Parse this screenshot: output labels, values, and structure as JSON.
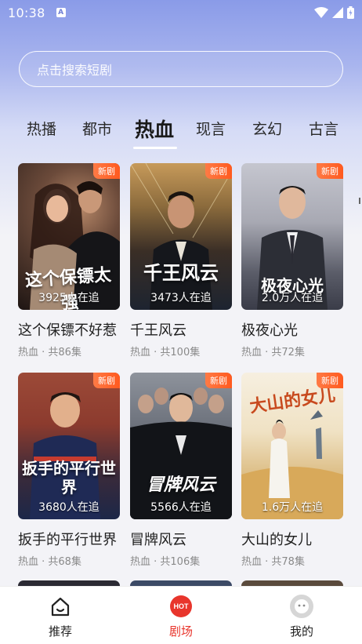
{
  "status_bar": {
    "time": "10:38",
    "indicator": "A"
  },
  "search": {
    "placeholder": "点击搜索短剧"
  },
  "tabs": [
    {
      "label": "热播"
    },
    {
      "label": "都市"
    },
    {
      "label": "热血",
      "active": true
    },
    {
      "label": "现言"
    },
    {
      "label": "玄幻"
    },
    {
      "label": "古言"
    }
  ],
  "dramas": [
    {
      "poster_text": "这个保镖太强",
      "badge": "新剧",
      "watching": "3925人在追",
      "title": "这个保镖不好惹",
      "meta": "热血 · 共86集",
      "colors": [
        "#6b4a3a",
        "#1e1513"
      ]
    },
    {
      "poster_text": "千王风云",
      "badge": "新剧",
      "watching": "3473人在追",
      "title": "千王风云",
      "meta": "热血 · 共100集",
      "colors": [
        "#8a6a3c",
        "#1d2430"
      ]
    },
    {
      "poster_text": "极夜心光",
      "badge": "新剧",
      "watching": "2.0万人在追",
      "title": "极夜心光",
      "meta": "热血 · 共72集",
      "colors": [
        "#a8a9b3",
        "#3a3c48"
      ]
    },
    {
      "poster_text": "扳手的平行世界",
      "badge": "新剧",
      "watching": "3680人在追",
      "title": "扳手的平行世界",
      "meta": "热血 · 共68集",
      "colors": [
        "#8c3b2e",
        "#1c2748"
      ]
    },
    {
      "poster_text": "冒牌风云",
      "badge": "新剧",
      "watching": "5566人在追",
      "title": "冒牌风云",
      "meta": "热血 · 共106集",
      "colors": [
        "#6e737d",
        "#14171c"
      ]
    },
    {
      "poster_text": "大山的女儿",
      "badge": "新剧",
      "watching": "1.6万人在追",
      "title": "大山的女儿",
      "meta": "热血 · 共78集",
      "colors": [
        "#f0e2c4",
        "#c79a4e"
      ]
    }
  ],
  "bottom_nav": [
    {
      "label": "推荐",
      "icon": "home-icon"
    },
    {
      "label": "剧场",
      "icon": "hot-icon",
      "icon_text": "HOT",
      "active": true
    },
    {
      "label": "我的",
      "icon": "profile-icon"
    }
  ],
  "accent_color": "#e8352c"
}
